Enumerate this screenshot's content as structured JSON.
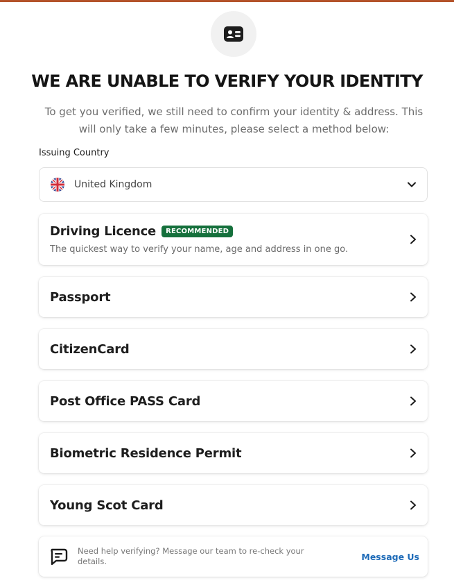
{
  "header": {
    "icon": "id-card-icon",
    "title": "WE ARE UNABLE TO VERIFY YOUR IDENTITY",
    "subtitle": "To get you verified, we still need to confirm your identity & address. This will only take a few minutes, please select a method below:"
  },
  "country": {
    "label": "Issuing Country",
    "value": "United Kingdom",
    "flag_icon": "uk-flag-icon"
  },
  "methods": [
    {
      "title": "Driving Licence",
      "badge": "RECOMMENDED",
      "description": "The quickest way to verify your name, age and address in one go."
    },
    {
      "title": "Passport"
    },
    {
      "title": "CitizenCard"
    },
    {
      "title": "Post Office PASS Card"
    },
    {
      "title": "Biometric Residence Permit"
    },
    {
      "title": "Young Scot Card"
    }
  ],
  "help": {
    "icon": "chat-bubble-icon",
    "text": "Need help verifying? Message our team to re-check your details.",
    "link": "Message Us"
  },
  "colors": {
    "accent_bar": "#b4532a",
    "badge": "#15703c",
    "link": "#1e6bb8"
  }
}
